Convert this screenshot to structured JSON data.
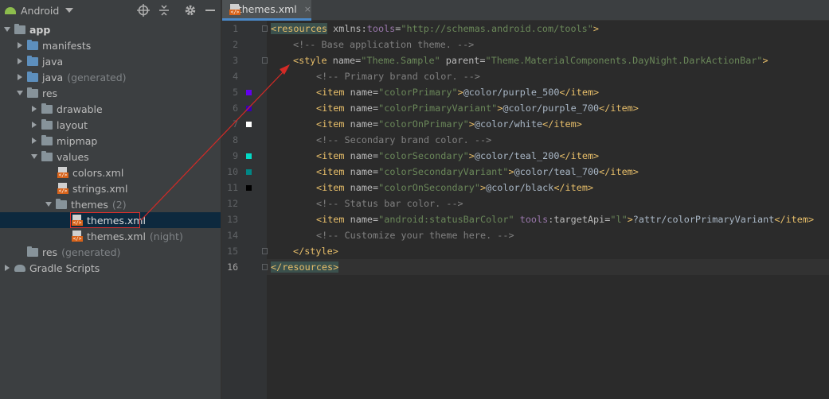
{
  "toolbar": {
    "view_mode": "Android",
    "icons": [
      "android-icon",
      "dropdown-arrow-icon",
      "crosshair-icon",
      "collapse-all-icon",
      "gear-icon",
      "minimize-icon"
    ]
  },
  "tree": {
    "app": "app",
    "manifests": "manifests",
    "java": "java",
    "java_gen": "java",
    "java_gen_sub": "(generated)",
    "res": "res",
    "drawable": "drawable",
    "layout": "layout",
    "mipmap": "mipmap",
    "values": "values",
    "colors": "colors.xml",
    "strings": "strings.xml",
    "themes": "themes",
    "themes_sub": "(2)",
    "themes_xml": "themes.xml",
    "themes_night": "themes.xml",
    "themes_night_sub": "(night)",
    "res_gen": "res",
    "res_gen_sub": "(generated)",
    "gradle": "Gradle Scripts"
  },
  "editor": {
    "tab_title": "themes.xml",
    "tab_close": "×",
    "line_numbers": [
      "1",
      "2",
      "3",
      "4",
      "5",
      "6",
      "7",
      "8",
      "9",
      "10",
      "11",
      "12",
      "13",
      "14",
      "15",
      "16"
    ],
    "current_line": 16,
    "colors": {
      "accent": "#4a88c7",
      "purple_500": "#6200ee",
      "purple_700": "#3700b3",
      "white": "#ffffff",
      "teal_200": "#03dac5",
      "teal_700": "#018786",
      "black": "#000000",
      "annotation": "#e0302c"
    },
    "code": {
      "l1": {
        "open": "<resources",
        "ns_pre": " xmlns:",
        "ns": "tools",
        "eq": "=",
        "val": "\"http://schemas.android.com/tools\"",
        "close": ">"
      },
      "l2": "<!-- Base application theme. -->",
      "l3": {
        "open": "<style",
        "a1": " name=",
        "v1": "\"Theme.Sample\"",
        "a2": " parent=",
        "v2": "\"Theme.MaterialComponents.DayNight.DarkActionBar\"",
        "close": ">"
      },
      "l4": "<!-- Primary brand color. -->",
      "l5": {
        "open": "<item",
        "a": " name=",
        "v": "\"colorPrimary\"",
        "gt": ">",
        "text": "@color/purple_500",
        "close": "</item>"
      },
      "l6": {
        "open": "<item",
        "a": " name=",
        "v": "\"colorPrimaryVariant\"",
        "gt": ">",
        "text": "@color/purple_700",
        "close": "</item>"
      },
      "l7": {
        "open": "<item",
        "a": " name=",
        "v": "\"colorOnPrimary\"",
        "gt": ">",
        "text": "@color/white",
        "close": "</item>"
      },
      "l8": "<!-- Secondary brand color. -->",
      "l9": {
        "open": "<item",
        "a": " name=",
        "v": "\"colorSecondary\"",
        "gt": ">",
        "text": "@color/teal_200",
        "close": "</item>"
      },
      "l10": {
        "open": "<item",
        "a": " name=",
        "v": "\"colorSecondaryVariant\"",
        "gt": ">",
        "text": "@color/teal_700",
        "close": "</item>"
      },
      "l11": {
        "open": "<item",
        "a": " name=",
        "v": "\"colorOnSecondary\"",
        "gt": ">",
        "text": "@color/black",
        "close": "</item>"
      },
      "l12": "<!-- Status bar color. -->",
      "l13": {
        "open": "<item",
        "a": " name=",
        "v": "\"android:statusBarColor\"",
        "ns": " tools",
        "ns_attr": ":targetApi=",
        "v2": "\"l\"",
        "gt": ">",
        "text": "?attr/colorPrimaryVariant",
        "close": "</item>"
      },
      "l14": "<!-- Customize your theme here. -->",
      "l15": "</style>",
      "l16": "</resources>"
    }
  }
}
